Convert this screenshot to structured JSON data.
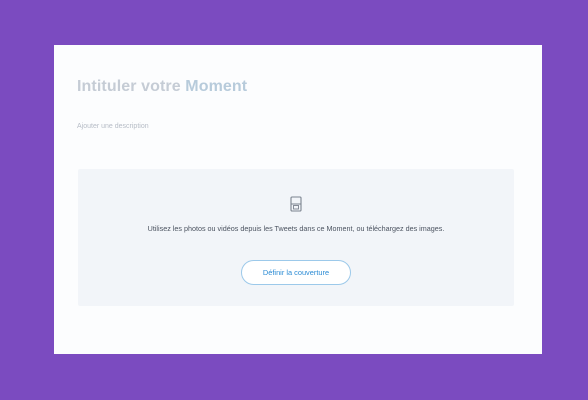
{
  "moment": {
    "title_prefix": "Intituler votre ",
    "title_highlight": "Moment",
    "description_placeholder": "Ajouter une description"
  },
  "cover": {
    "icon": "media-placeholder-icon",
    "instruction": "Utilisez les photos ou vidéos depuis les Tweets dans ce Moment, ou téléchargez des images.",
    "button_label": "Définir la couverture"
  },
  "colors": {
    "background": "#7b4bc0",
    "card": "#fcfdfe",
    "panel": "#f2f5f9",
    "accent": "#2b8bd4"
  }
}
